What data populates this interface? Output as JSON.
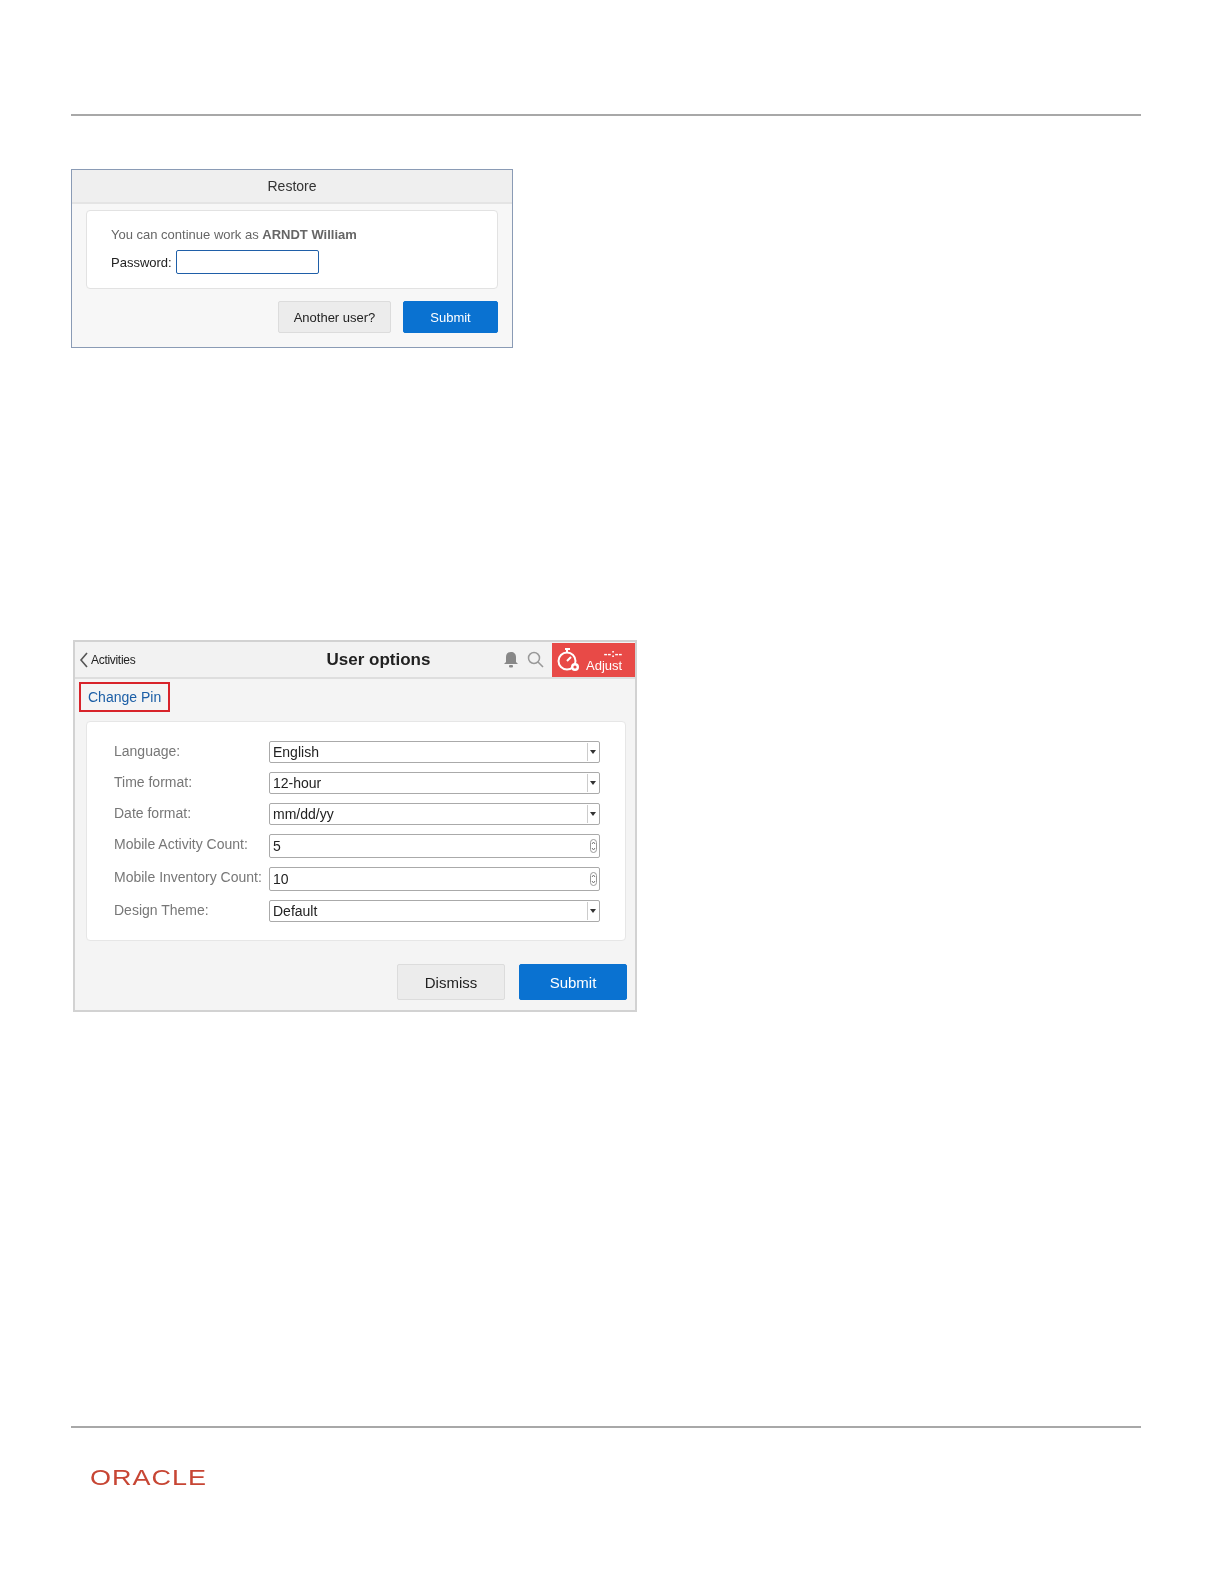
{
  "restore_dialog": {
    "title": "Restore",
    "message": "You can continue work as **ARNDT William**",
    "password_label": "Password:",
    "buttons": [
      {
        "label": "Another user?",
        "kind": "secondary"
      },
      {
        "label": "Submit",
        "kind": "primary"
      }
    ]
  },
  "user_options": {
    "back_label": "Activities",
    "title": "User options",
    "timer": {
      "time": "--:--",
      "label": "Adjust"
    },
    "change_pin": {
      "label": "Change Pin",
      "highlighted": true
    },
    "fields": [
      {
        "label": "Language:",
        "value": "English",
        "kind": "select"
      },
      {
        "label": "Time format:",
        "value": "12-hour",
        "kind": "select"
      },
      {
        "label": "Date format:",
        "value": "mm/dd/yy",
        "kind": "select"
      },
      {
        "label": "Mobile Activity Count:",
        "value": "5",
        "kind": "number"
      },
      {
        "label": "Mobile Inventory Count:",
        "value": "10",
        "kind": "number"
      },
      {
        "label": "Design Theme:",
        "value": "Default",
        "kind": "select"
      }
    ],
    "buttons": [
      {
        "label": "Dismiss",
        "kind": "secondary"
      },
      {
        "label": "Submit",
        "kind": "primary"
      }
    ]
  },
  "footer": {
    "logo": "ORACLE"
  }
}
